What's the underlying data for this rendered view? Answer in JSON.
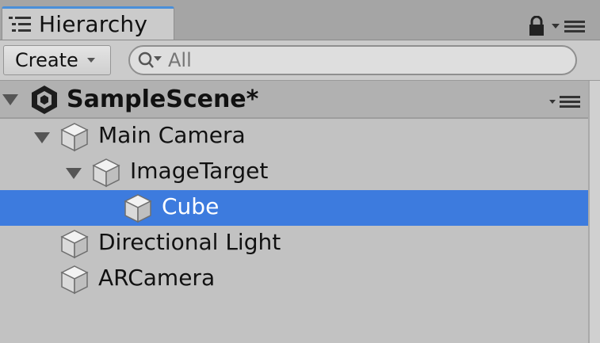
{
  "window": {
    "tab_title": "Hierarchy"
  },
  "toolbar": {
    "create_label": "Create",
    "search_placeholder": "All"
  },
  "scene": {
    "name": "SampleScene*"
  },
  "hierarchy": [
    {
      "label": "Main Camera",
      "depth": 1,
      "expanded": true,
      "selected": false
    },
    {
      "label": "ImageTarget",
      "depth": 2,
      "expanded": true,
      "selected": false
    },
    {
      "label": "Cube",
      "depth": 3,
      "expanded": false,
      "selected": true
    },
    {
      "label": "Directional Light",
      "depth": 1,
      "expanded": false,
      "selected": false
    },
    {
      "label": "ARCamera",
      "depth": 1,
      "expanded": false,
      "selected": false
    }
  ],
  "colors": {
    "selection": "#3d7bde",
    "tab_accent": "#4a8fd9",
    "panel_bg": "#c2c2c2"
  },
  "icons": {
    "tab": "hierarchy-list-icon",
    "lock": "lock-icon",
    "menu": "panel-menu-icon",
    "scene": "unity-logo-icon",
    "object": "gameobject-cube-icon",
    "fold": "expand-triangle-icon"
  }
}
